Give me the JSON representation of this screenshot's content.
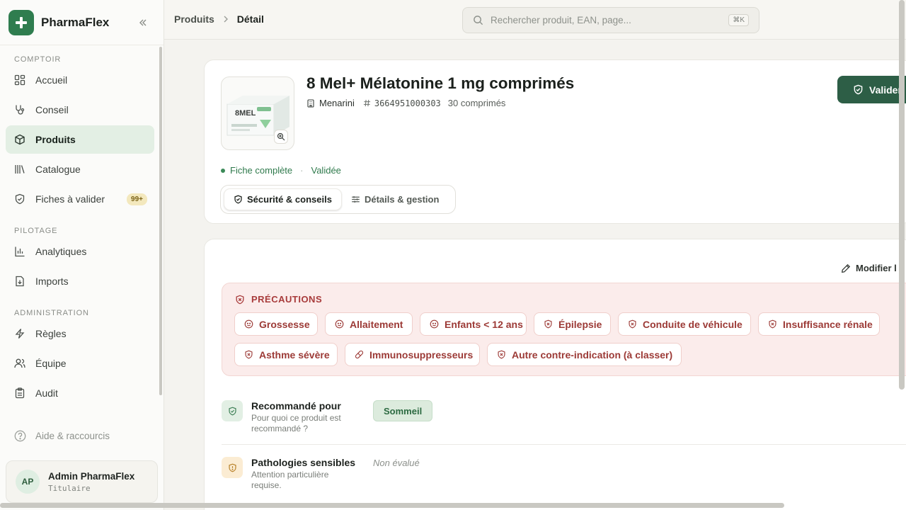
{
  "app": {
    "name": "PharmaFlex"
  },
  "sidebar": {
    "sections": [
      "COMPTOIR",
      "PILOTAGE",
      "ADMINISTRATION"
    ],
    "items": [
      {
        "label": "Accueil",
        "icon": "grid-icon"
      },
      {
        "label": "Conseil",
        "icon": "stethoscope-icon"
      },
      {
        "label": "Produits",
        "icon": "box-icon",
        "active": true
      },
      {
        "label": "Catalogue",
        "icon": "library-icon"
      },
      {
        "label": "Fiches à valider",
        "icon": "shield-icon",
        "badge": "99+"
      },
      {
        "label": "Analytiques",
        "icon": "bar-chart-icon"
      },
      {
        "label": "Imports",
        "icon": "file-import-icon"
      },
      {
        "label": "Règles",
        "icon": "bolt-icon"
      },
      {
        "label": "Équipe",
        "icon": "users-icon"
      },
      {
        "label": "Audit",
        "icon": "clipboard-icon"
      }
    ],
    "help": "Aide & raccourcis",
    "user": {
      "initials": "AP",
      "name": "Admin PharmaFlex",
      "role": "Titulaire"
    }
  },
  "topbar": {
    "breadcrumb": [
      "Produits",
      "Détail"
    ],
    "search_placeholder": "Rechercher produit, EAN, page...",
    "shortcut": "⌘K"
  },
  "product": {
    "title": "8 Mel+ Mélatonine 1 mg comprimés",
    "brand": "Menarini",
    "ean": "3664951000303",
    "quantity": "30 comprimés",
    "validate_label": "Valider",
    "status": "Fiche complète",
    "status_state": "Validée",
    "thumb_text": "8MEL",
    "tabs": [
      "Sécurité & conseils",
      "Détails & gestion"
    ]
  },
  "safety": {
    "edit_label": "Modifier l",
    "precautions_title": "PRÉCAUTIONS",
    "chips": [
      "Grossesse",
      "Allaitement",
      "Enfants < 12 ans",
      "Épilepsie",
      "Conduite de véhicule",
      "Insuffisance rénale",
      "Asthme sévère",
      "Immunosuppresseurs",
      "Autre contre-indication (à classer)"
    ],
    "recommended": {
      "title": "Recommandé pour",
      "subtitle": "Pour quoi ce produit est recommandé ?",
      "value": "Sommeil"
    },
    "pathologies": {
      "title": "Pathologies sensibles",
      "subtitle": "Attention particulière requise.",
      "value": "Non évalué"
    }
  },
  "colors": {
    "accent": "#2f7d4f",
    "validate": "#2d5e46",
    "danger": "#a83b3b"
  }
}
